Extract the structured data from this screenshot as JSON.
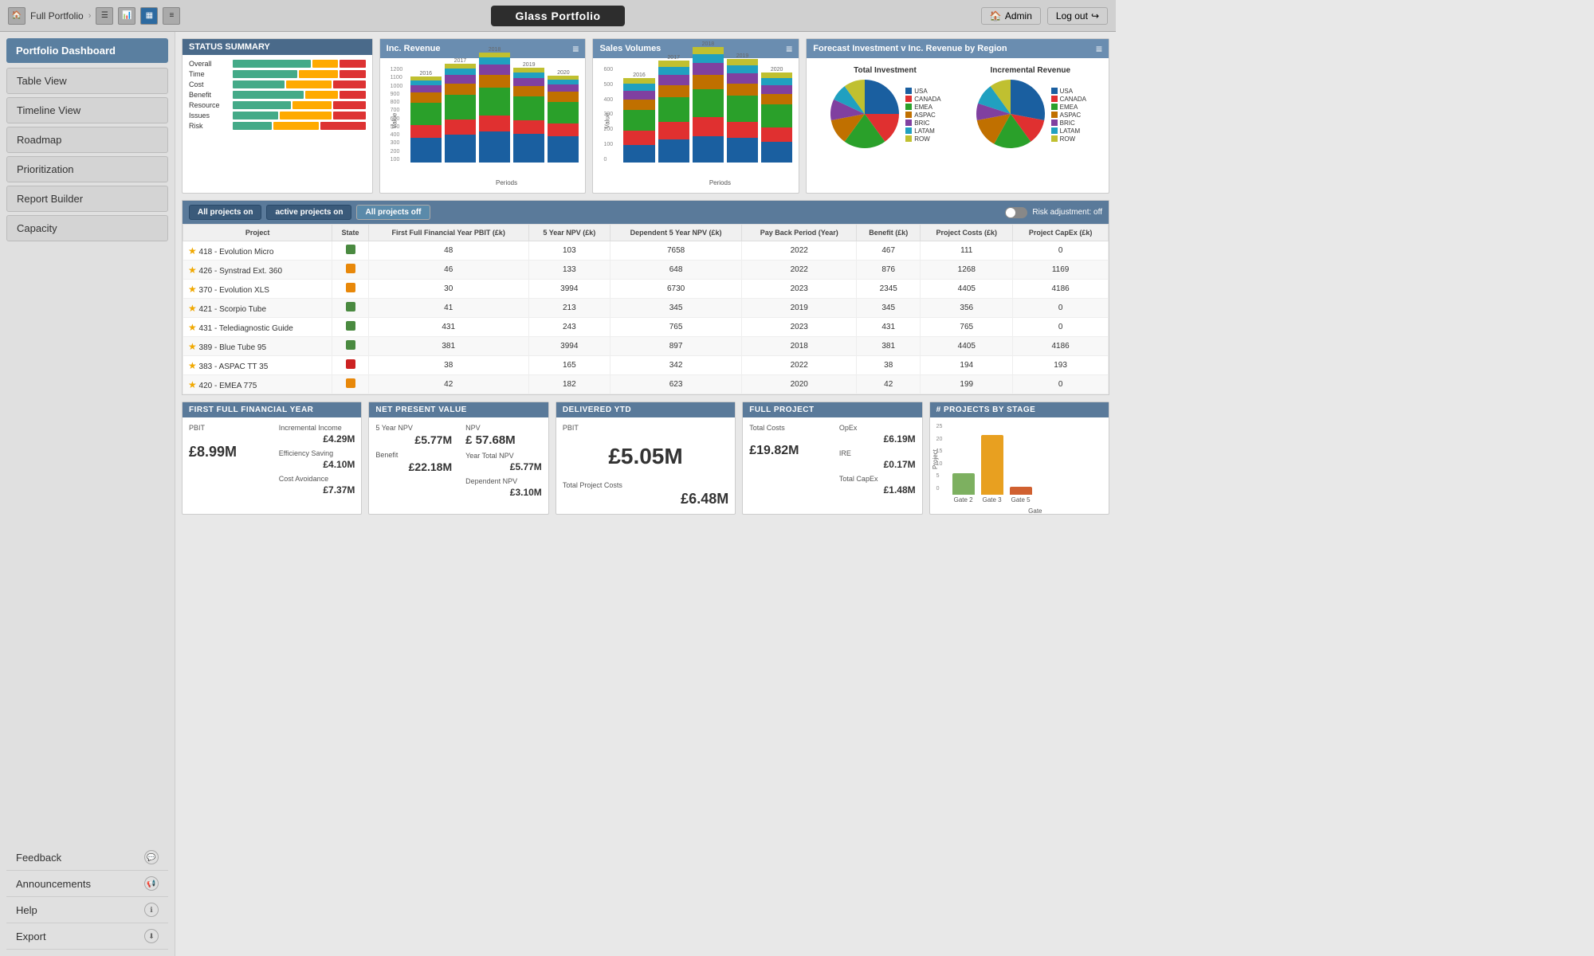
{
  "topbar": {
    "portfolio_name": "Full Portfolio",
    "title": "Glass Portfolio",
    "admin_label": "Admin",
    "logout_label": "Log out",
    "icons": [
      "table-icon",
      "bar-icon",
      "mixed-icon",
      "list-icon"
    ]
  },
  "sidebar": {
    "title": "Portfolio Dashboard",
    "items": [
      {
        "label": "Table View",
        "id": "table-view"
      },
      {
        "label": "Timeline View",
        "id": "timeline-view"
      },
      {
        "label": "Roadmap",
        "id": "roadmap"
      },
      {
        "label": "Prioritization",
        "id": "prioritization"
      },
      {
        "label": "Report Builder",
        "id": "report-builder"
      },
      {
        "label": "Capacity",
        "id": "capacity"
      }
    ],
    "bottom_items": [
      {
        "label": "Feedback",
        "id": "feedback",
        "icon": "chat"
      },
      {
        "label": "Announcements",
        "id": "announcements",
        "icon": "megaphone"
      },
      {
        "label": "Help",
        "id": "help",
        "icon": "info"
      },
      {
        "label": "Export",
        "id": "export",
        "icon": "download"
      }
    ]
  },
  "status_summary": {
    "title": "STATUS SUMMARY",
    "rows": [
      {
        "label": "Overall",
        "green": 60,
        "yellow": 20,
        "red": 20
      },
      {
        "label": "Time",
        "green": 50,
        "yellow": 30,
        "red": 20
      },
      {
        "label": "Cost",
        "green": 40,
        "yellow": 35,
        "red": 25
      },
      {
        "label": "Benefit",
        "green": 55,
        "yellow": 25,
        "red": 20
      },
      {
        "label": "Resource",
        "green": 45,
        "yellow": 30,
        "red": 25
      },
      {
        "label": "Issues",
        "green": 35,
        "yellow": 40,
        "red": 25
      },
      {
        "label": "Risk",
        "green": 30,
        "yellow": 35,
        "red": 35
      }
    ]
  },
  "inc_revenue": {
    "title": "Inc. Revenue",
    "y_label": "Value",
    "x_label": "Periods",
    "years": [
      "2016",
      "2017",
      "2018",
      "2019",
      "2020"
    ],
    "series": {
      "USA": [
        200,
        220,
        250,
        230,
        210
      ],
      "CANADA": [
        100,
        120,
        130,
        110,
        100
      ],
      "EMEA": [
        180,
        200,
        220,
        190,
        170
      ],
      "ASPAC": [
        80,
        90,
        100,
        85,
        80
      ],
      "BRIC": [
        60,
        70,
        80,
        65,
        60
      ],
      "LATAM": [
        40,
        50,
        55,
        45,
        40
      ],
      "ROW": [
        30,
        35,
        40,
        35,
        30
      ]
    },
    "colors": {
      "USA": "#1a5fa0",
      "CANADA": "#e03030",
      "EMEA": "#2aa02a",
      "ASPAC": "#c07000",
      "BRIC": "#8040a0",
      "LATAM": "#20a0c0",
      "ROW": "#c0c030"
    }
  },
  "sales_volumes": {
    "title": "Sales Volumes",
    "y_label": "Value",
    "x_label": "Periods",
    "years": [
      "2016",
      "2017",
      "2018",
      "2019",
      "2020"
    ],
    "series": {
      "USA": [
        100,
        130,
        150,
        140,
        120
      ],
      "CANADA": [
        80,
        100,
        110,
        90,
        80
      ],
      "EMEA": [
        120,
        140,
        160,
        150,
        130
      ],
      "ASPAC": [
        60,
        70,
        80,
        70,
        60
      ],
      "BRIC": [
        50,
        60,
        70,
        60,
        50
      ],
      "LATAM": [
        40,
        45,
        50,
        45,
        40
      ],
      "ROW": [
        30,
        35,
        40,
        35,
        30
      ]
    },
    "colors": {
      "USA": "#1a5fa0",
      "CANADA": "#e03030",
      "EMEA": "#2aa02a",
      "ASPAC": "#c07000",
      "BRIC": "#8040a0",
      "LATAM": "#20a0c0",
      "ROW": "#c0c030"
    }
  },
  "forecast": {
    "title": "Forecast Investment v Inc. Revenue by Region",
    "total_investment_label": "Total Investment",
    "incremental_revenue_label": "Incremental Revenue",
    "regions": [
      "USA",
      "CANADA",
      "EMEA",
      "ASPAC",
      "BRIC",
      "LATAM",
      "ROW"
    ],
    "colors": [
      "#1a5fa0",
      "#e03030",
      "#2aa02a",
      "#c07000",
      "#8040a0",
      "#20a0c0",
      "#c0c030"
    ],
    "ti_values": [
      25,
      15,
      20,
      12,
      10,
      8,
      10
    ],
    "ir_values": [
      28,
      12,
      18,
      14,
      8,
      10,
      10
    ]
  },
  "toggle": {
    "all_projects_on": "All projects on",
    "active_projects_on": "active projects on",
    "all_projects_off": "All projects off",
    "risk_label": "Risk adjustment: off"
  },
  "project_table": {
    "headers": [
      "Project",
      "State",
      "First Full Financial Year PBIT (£k)",
      "5 Year NPV (£k)",
      "Dependent 5 Year NPV (£k)",
      "Pay Back Period (Year)",
      "Benefit (£k)",
      "Project Costs (£k)",
      "Project CapEx (£k)"
    ],
    "rows": [
      {
        "star": true,
        "name": "418 - Evolution Micro",
        "state": "green",
        "pbit": 48,
        "npv5": 103,
        "dep_npv": 7658,
        "payback": 2022,
        "benefit": 467,
        "cost": 111,
        "capex": 0
      },
      {
        "star": true,
        "name": "426 - Synstrad Ext. 360",
        "state": "orange",
        "pbit": 46,
        "npv5": 133,
        "dep_npv": 648,
        "payback": 2022,
        "benefit": 876,
        "cost": 1268,
        "capex": 1169
      },
      {
        "star": true,
        "name": "370 - Evolution XLS",
        "state": "orange",
        "pbit": 30,
        "npv5": 3994,
        "dep_npv": 6730,
        "payback": 2023,
        "benefit": 2345,
        "cost": 4405,
        "capex": 4186
      },
      {
        "star": true,
        "name": "421 - Scorpio Tube",
        "state": "green",
        "pbit": 41,
        "npv5": 213,
        "dep_npv": 345,
        "payback": 2019,
        "benefit": 345,
        "cost": 356,
        "capex": 0
      },
      {
        "star": true,
        "name": "431 - Telediagnostic Guide",
        "state": "green",
        "pbit": 431,
        "npv5": 243,
        "dep_npv": 765,
        "payback": 2023,
        "benefit": 431,
        "cost": 765,
        "capex": 0
      },
      {
        "star": true,
        "name": "389 - Blue Tube 95",
        "state": "green",
        "pbit": 381,
        "npv5": 3994,
        "dep_npv": 897,
        "payback": 2018,
        "benefit": 381,
        "cost": 4405,
        "capex": 4186
      },
      {
        "star": true,
        "name": "383 - ASPAC TT 35",
        "state": "red",
        "pbit": 38,
        "npv5": 165,
        "dep_npv": 342,
        "payback": 2022,
        "benefit": 38,
        "cost": 194,
        "capex": 193
      },
      {
        "star": true,
        "name": "420 - EMEA 775",
        "state": "orange",
        "pbit": 42,
        "npv5": 182,
        "dep_npv": 623,
        "payback": 2020,
        "benefit": 42,
        "cost": 199,
        "capex": 0
      }
    ]
  },
  "first_full_fy": {
    "title": "FIRST FULL FINANCIAL YEAR",
    "pbit_label": "PBIT",
    "pbit_value": "£8.99M",
    "incremental_income_label": "Incremental Income",
    "incremental_income_value": "£4.29M",
    "efficiency_saving_label": "Efficiency Saving",
    "efficiency_saving_value": "£4.10M",
    "cost_avoidance_label": "Cost Avoidance",
    "cost_avoidance_value": "£7.37M"
  },
  "npv": {
    "title": "NET PRESENT VALUE",
    "five_year_npv_label": "5 Year NPV",
    "five_year_npv_value": "£5.77M",
    "npv_label": "NPV",
    "npv_value": "£ 57.68M",
    "year_total_npv_label": "Year Total NPV",
    "year_total_npv_value": "£5.77M",
    "benefit_label": "Benefit",
    "benefit_value": "£22.18M",
    "dep_npv_label": "Dependent NPV",
    "dep_npv_value": "£3.10M"
  },
  "delivered_ytd": {
    "title": "DELIVERED YTD",
    "pbit_label": "PBIT",
    "pbit_value": "£5.05M",
    "total_project_costs_label": "Total Project Costs",
    "total_project_costs_value": "£6.48M"
  },
  "full_project": {
    "title": "FULL PROJECT",
    "total_costs_label": "Total Costs",
    "total_costs_value": "£19.82M",
    "opex_label": "OpEx",
    "opex_value": "£6.19M",
    "ire_label": "IRE",
    "ire_value": "£0.17M",
    "total_capex_label": "Total CapEx",
    "total_capex_value": "£1.48M"
  },
  "projects_by_stage": {
    "title": "# PROJECTS BY STAGE",
    "x_label": "Gate",
    "y_label": "Project",
    "bars": [
      {
        "label": "Gate 2",
        "value": 8,
        "color": "#7db060"
      },
      {
        "label": "Gate 3",
        "value": 22,
        "color": "#e8a020"
      },
      {
        "label": "Gate 5",
        "value": 3,
        "color": "#d06030"
      }
    ],
    "y_max": 25
  }
}
